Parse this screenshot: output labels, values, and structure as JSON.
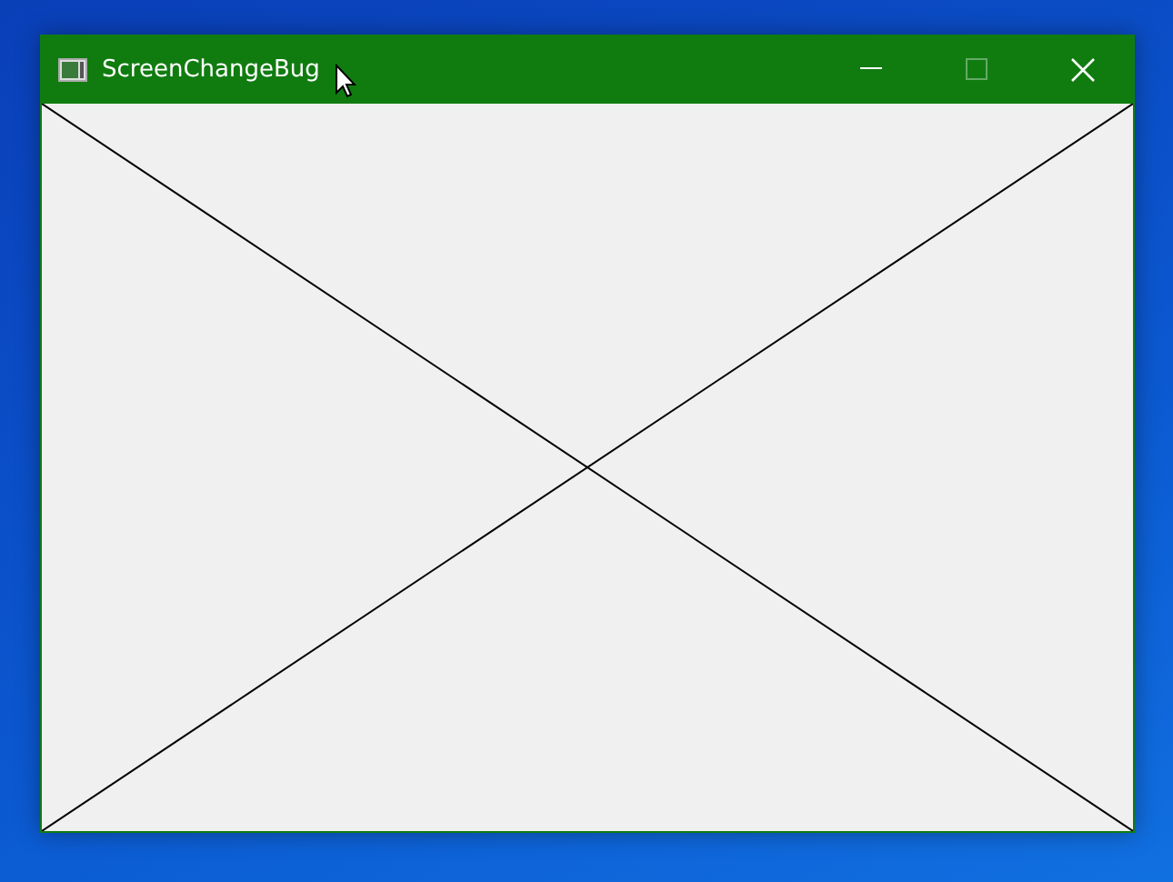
{
  "window": {
    "title": "ScreenChangeBug"
  },
  "title_buttons": [
    {
      "kind": "minimize",
      "disabled": false
    },
    {
      "kind": "maximize",
      "disabled": true
    },
    {
      "kind": "close",
      "disabled": false
    }
  ]
}
